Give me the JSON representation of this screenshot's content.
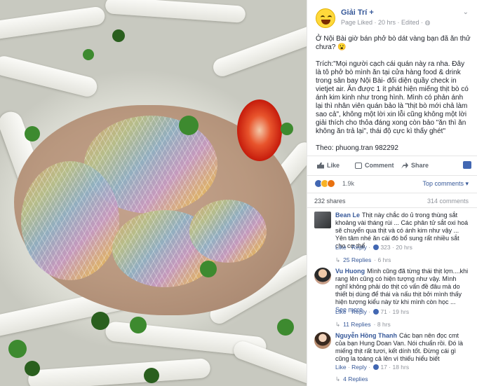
{
  "page": {
    "name": "Giải Trí +",
    "meta": "Page Liked · 20 hrs · Edited · ",
    "options_icon": "chevron-down-icon"
  },
  "post": {
    "title": "Ở Nội Bài giờ bán phở bò dát vàng bạn đã ăn thử chưa? 😮",
    "body": "Trích:\"Mọi người cạch cái quán này ra nha. Đây là tô phở bò mình ăn tại cửa hàng food & drink trong sân bay Nội Bài- đối diện quầy check in vietjet air. Ăn được 1 ít phát hiện miếng thịt bò có ánh kim kinh như trong hình. Mình có phản ánh lại thì nhân viên quán bảo là \"thịt bò mới chả làm sao cả\", không một lời xin lỗi cũng không một lời giải thích cho thỏa đáng xong còn bảo \"ăn thì ăn không ăn trả lại\", thái độ cực kì thấy ghét\"",
    "source": "Theo: phuong.tran 982292"
  },
  "actions": {
    "like": "Like",
    "comment": "Comment",
    "share": "Share"
  },
  "reactions": {
    "count": "1.9k",
    "comments_label": "Top comments ▾",
    "shares": "232 shares",
    "comments_count": "314 comments"
  },
  "comments": [
    {
      "author": "Bean Le",
      "text": "Thịt này chắc do ủ trong thùng sắt khoảng vài tháng rùi ... Các phân tử sắt oxi hoá sẽ chuyển qua thịt và có ánh kim như vậy ... Yên tâm nhé ăn cái đó bổ sung rất nhiều sắt cho cơ thể",
      "like": "Like",
      "reply": "Reply",
      "likes": "323",
      "time": "20 hrs",
      "replies": "25 Replies",
      "replies_time": "6 hrs"
    },
    {
      "author": "Vu Huong",
      "text": "Mình cũng đã từng thái thịt lợn....khi rang lên cũng có hiện tượng như vậy. Mình nghĩ không phải do thịt có vấn đề đâu mà do thiết bị dùng để thái và nấu thịt bởi mình thấy hiện tượng kiểu này từ khi mình còn học ...",
      "more": "See more",
      "like": "Like",
      "reply": "Reply",
      "likes": "71",
      "time": "19 hrs",
      "replies": "11 Replies",
      "replies_time": "8 hrs"
    },
    {
      "author": "Nguyễn Hồng Thanh",
      "text": "Các bạn nên đọc cmt của bạn Hung Doan Van. Nói chuẩn rồi. Đó là miếng thịt rất tươi, kết dính tốt. Đừng cái gì cũng la toáng cả lên vì thiếu hiểu biết",
      "like": "Like",
      "reply": "Reply",
      "likes": "17",
      "time": "18 hrs",
      "replies": "4 Replies"
    }
  ],
  "colors": {
    "link": "#365899",
    "meta": "#90949c",
    "text": "#1d2129",
    "like_blue": "#4267b2"
  }
}
